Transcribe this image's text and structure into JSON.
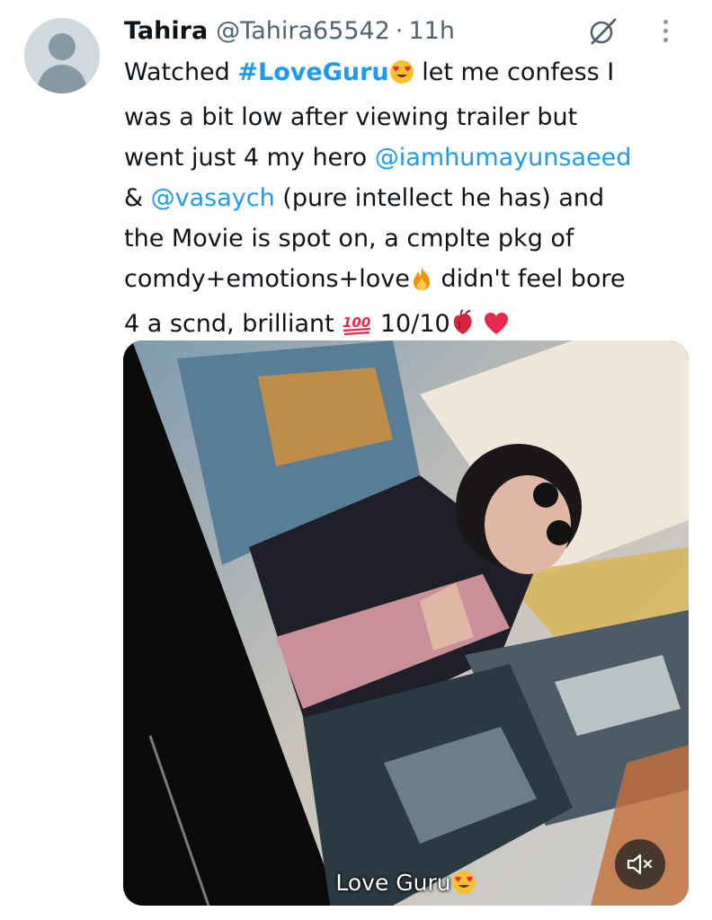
{
  "author": {
    "name": "Tahira",
    "handle": "@Tahira65542",
    "separator": "·",
    "time": "11h"
  },
  "tweet": {
    "lines": [
      [
        {
          "t": "text",
          "v": "Watched "
        },
        {
          "t": "hashtag",
          "v": "#LoveGuru"
        },
        {
          "t": "emoji",
          "v": "smiling-face-heart-eyes"
        },
        {
          "t": "text",
          "v": " let me confess I"
        }
      ],
      [
        {
          "t": "text",
          "v": "was a bit low after viewing trailer but"
        }
      ],
      [
        {
          "t": "text",
          "v": "went just 4 my hero "
        },
        {
          "t": "mention",
          "v": "@iamhumayunsaeed"
        }
      ],
      [
        {
          "t": "text",
          "v": "& "
        },
        {
          "t": "mention",
          "v": "@vasaych"
        },
        {
          "t": "text",
          "v": " (pure intellect he has) and"
        }
      ],
      [
        {
          "t": "text",
          "v": "the Movie is spot on, a cmplte pkg of"
        }
      ],
      [
        {
          "t": "text",
          "v": "comdy+emotions+love"
        },
        {
          "t": "emoji",
          "v": "fire"
        },
        {
          "t": "text",
          "v": " didn't feel bore"
        }
      ],
      [
        {
          "t": "text",
          "v": "4 a scnd, brilliant "
        },
        {
          "t": "emoji",
          "v": "hundred-points"
        },
        {
          "t": "text",
          "v": " 10/10"
        },
        {
          "t": "emoji",
          "v": "anatomical-heart"
        },
        {
          "t": "text",
          "v": " "
        },
        {
          "t": "emoji",
          "v": "red-heart"
        }
      ]
    ]
  },
  "media": {
    "caption": "Love Guru",
    "caption_emoji": "smiling-face-heart-eyes",
    "mute_icon": "speaker-muted-icon"
  },
  "icons": {
    "grok": "grok-icon",
    "more": "more-options-icon"
  },
  "colors": {
    "link": "#1d9bf0",
    "secondary_text": "#536471",
    "primary_text": "#0f1419"
  }
}
